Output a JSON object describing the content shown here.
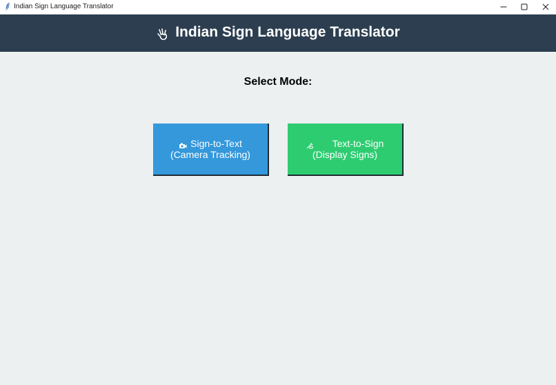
{
  "window": {
    "title": "Indian Sign Language Translator",
    "icons": {
      "app": "feather-icon",
      "minimize": "minimize-icon",
      "maximize": "maximize-icon",
      "close": "close-icon"
    }
  },
  "header": {
    "icon": "hand-sign-icon",
    "title": "Indian Sign Language Translator",
    "background": "#2c3e50"
  },
  "main": {
    "select_label": "Select Mode:",
    "modes": [
      {
        "icon": "camera-icon",
        "label_line1": "Sign-to-Text",
        "label_line2": "(Camera Tracking)",
        "color": "#3498db"
      },
      {
        "icon": "writing-hand-icon",
        "label_line1": "Text-to-Sign",
        "label_line2": "(Display Signs)",
        "color": "#2ecc71"
      }
    ]
  },
  "colors": {
    "background": "#ecf0f1",
    "text_primary": "#000000",
    "button_text": "#ffffff"
  }
}
